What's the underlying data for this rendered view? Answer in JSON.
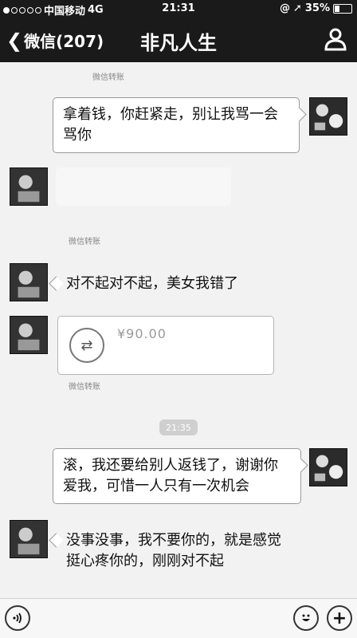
{
  "status_bar": {
    "carrier": "中国移动",
    "network": "4G",
    "time": "21:31",
    "battery": "35%",
    "battery_level": 0.35
  },
  "nav": {
    "back_label": "微信(207)",
    "title": "非凡人生"
  },
  "chat": {
    "captions": [
      "微信转账",
      "微信转账",
      "微信转账"
    ],
    "messages": [
      {
        "side": "right",
        "text": "拿着钱，你赶紧走，别让我骂一会骂你"
      },
      {
        "side": "left",
        "text": "对不起对不起，美女我错了"
      },
      {
        "side": "right",
        "text": "滚，我还要给别人返钱了，谢谢你爱我，可惜一人只有一次机会"
      },
      {
        "side": "left",
        "text": "没事没事，我不要你的，就是感觉挺心疼你的，刚刚对不起"
      }
    ],
    "transfer": {
      "amount": "¥90.00"
    },
    "time_badge": "21:35"
  },
  "icons": {
    "back": "chevron-left-icon",
    "profile": "person-icon",
    "voice": "voice-icon",
    "emoji": "emoji-icon",
    "plus": "plus-icon",
    "transfer": "transfer-icon"
  }
}
